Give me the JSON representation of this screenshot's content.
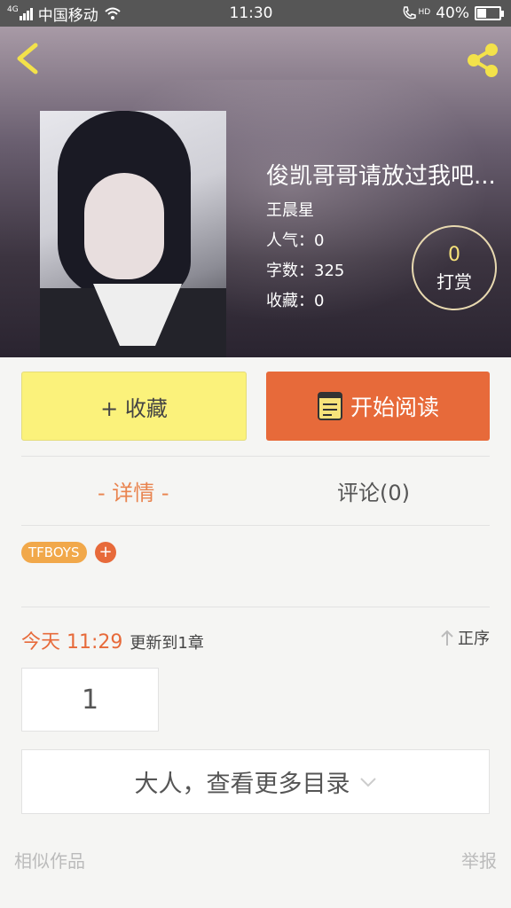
{
  "status_bar": {
    "signal_label": "4G",
    "carrier": "中国移动",
    "time": "11:30",
    "hd_label": "HD",
    "battery": "40%"
  },
  "book": {
    "title": "俊凯哥哥请放过我吧...",
    "author": "王晨星",
    "popularity": "人气：0",
    "word_count": "字数：325",
    "favorites": "收藏：0"
  },
  "tip": {
    "count": "0",
    "label": "打赏"
  },
  "actions": {
    "collect_label": "+ 收藏",
    "read_label": "开始阅读"
  },
  "tabs": {
    "detail": "- 详情 -",
    "comments": "评论(0)"
  },
  "tags": {
    "items": [
      "TFBOYS"
    ],
    "add_label": "+"
  },
  "update": {
    "date": "今天 11:29",
    "text": "更新到1章",
    "order_label": "正序"
  },
  "chapters": {
    "first": "1",
    "more_label": "大人，查看更多目录"
  },
  "footer": {
    "similar_label": "相似作品",
    "report_label": "举报"
  },
  "colors": {
    "accent": "#e76a3a",
    "collect_bg": "#fbf27b",
    "tag": "#f1a84a",
    "tip_count": "#f7e37a"
  }
}
